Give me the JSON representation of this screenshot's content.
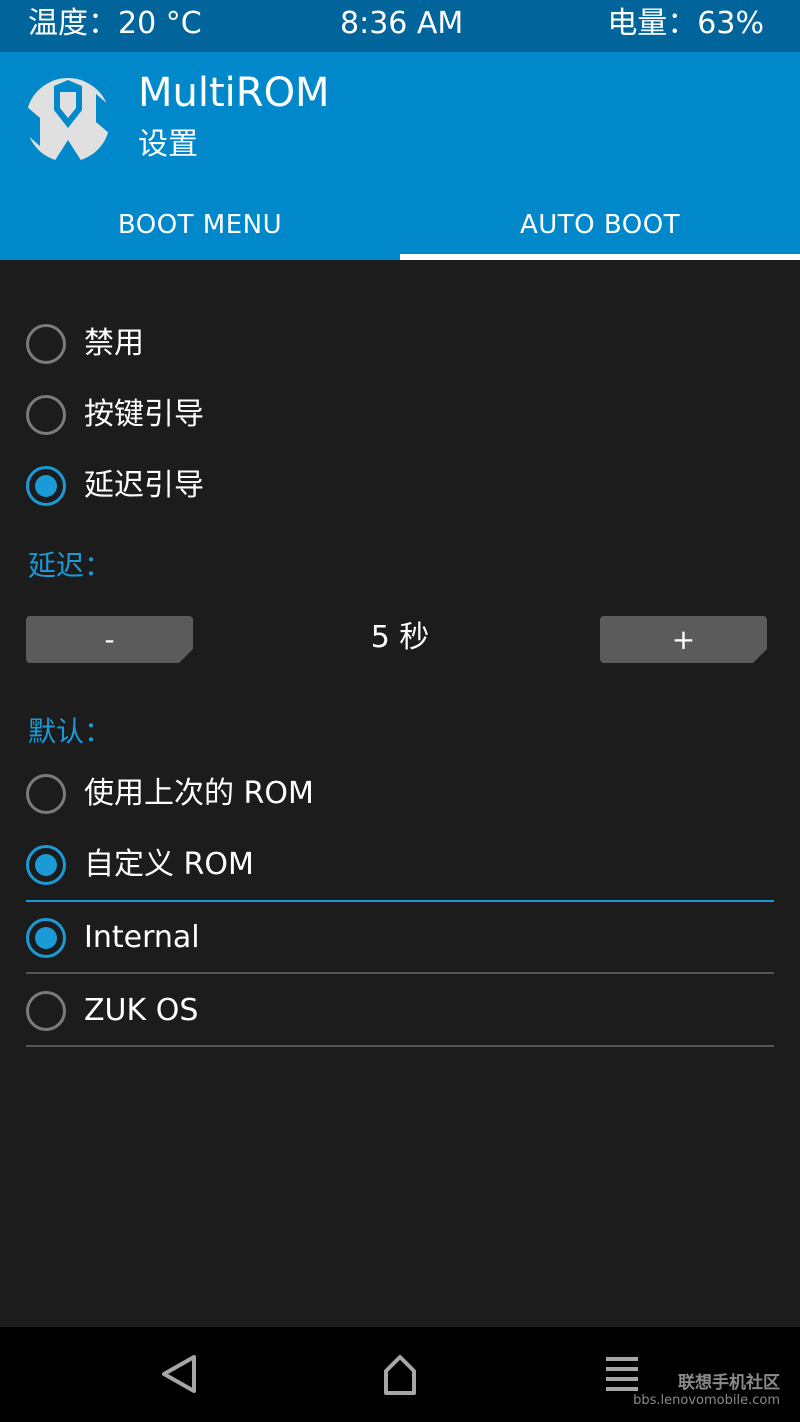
{
  "status_bar": {
    "temperature": "温度：20 °C",
    "time": "8:36 AM",
    "battery": "电量：63%"
  },
  "header": {
    "title": "MultiROM",
    "subtitle": "设置",
    "logo_icon": "twrp-logo-icon"
  },
  "tabs": [
    {
      "label": "BOOT MENU",
      "active": false
    },
    {
      "label": "AUTO BOOT",
      "active": true
    }
  ],
  "boot_mode": {
    "options": [
      {
        "label": "禁用",
        "checked": false
      },
      {
        "label": "按键引导",
        "checked": false
      },
      {
        "label": "延迟引导",
        "checked": true
      }
    ]
  },
  "delay": {
    "label": "延迟：",
    "minus_label": "-",
    "plus_label": "+",
    "value": "5 秒"
  },
  "default_rom": {
    "label": "默认：",
    "options": [
      {
        "label": "使用上次的 ROM",
        "checked": false
      },
      {
        "label": "自定义 ROM",
        "checked": true
      }
    ],
    "rom_list": [
      {
        "label": "Internal",
        "checked": true
      },
      {
        "label": "ZUK OS",
        "checked": false
      }
    ]
  },
  "nav_bar": {
    "back_icon": "back-triangle-icon",
    "home_icon": "home-icon",
    "menu_icon": "menu-lines-icon"
  },
  "watermark": {
    "title": "联想手机社区",
    "url": "bbs.lenovomobile.com"
  },
  "colors": {
    "status_bar": "#01659b",
    "header": "#0088cb",
    "accent": "#1a9ad6",
    "background": "#1c1c1c",
    "button": "#5b5b5b"
  }
}
